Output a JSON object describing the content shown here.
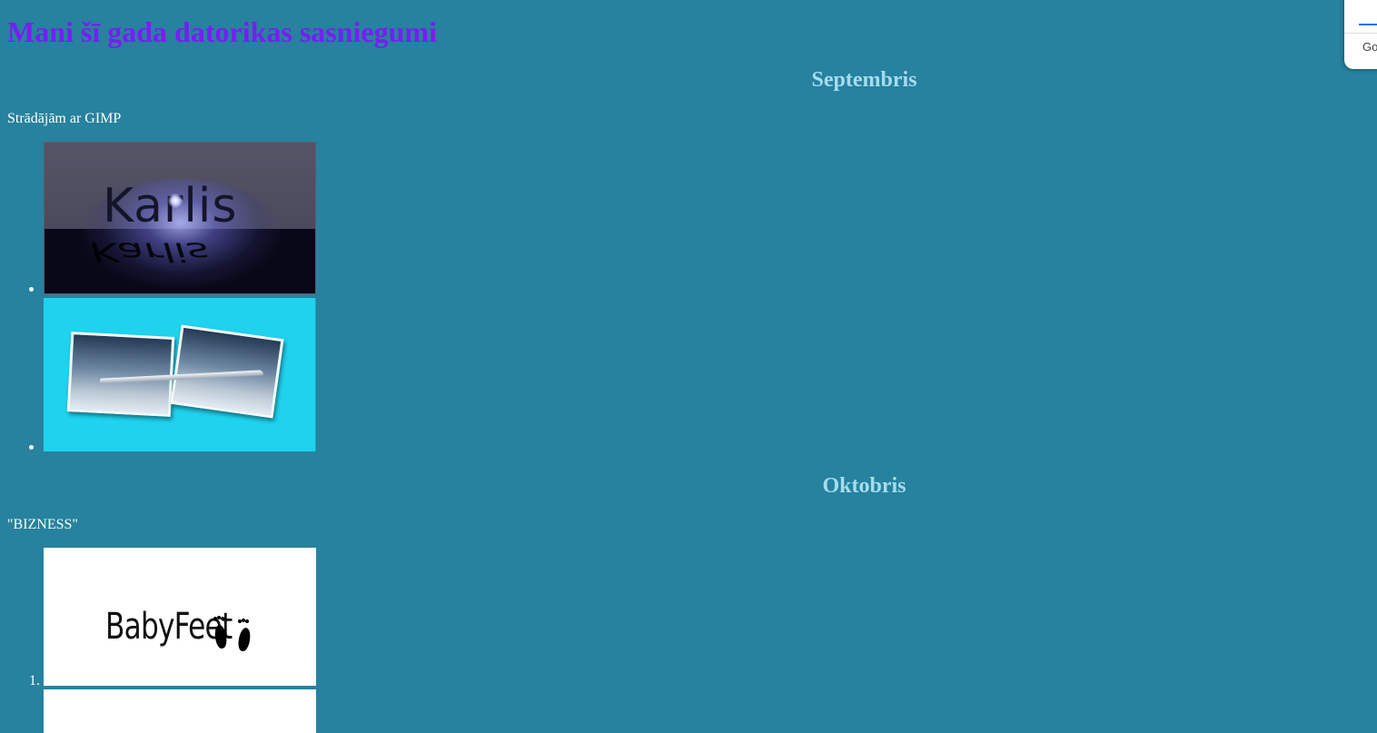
{
  "page": {
    "title": "Mani šī gada datorikas sasniegumi"
  },
  "sections": [
    {
      "month": "Septembris",
      "caption": "Strādājām ar GIMP",
      "images": [
        {
          "text": "Karlis",
          "reflection": "Karlis"
        },
        {
          "description_icon": "plane-photos-icon"
        }
      ]
    },
    {
      "month": "Oktobris",
      "caption": "\"BIZNESS\"",
      "list_marker": "1.",
      "images": [
        {
          "text": "BabyFeet"
        },
        {}
      ]
    }
  ],
  "corner_widget": {
    "text": "Go"
  },
  "colors": {
    "background": "#26829e",
    "title": "#7a1cf5",
    "month_heading": "#a6dcf0",
    "text": "#ffffff"
  }
}
